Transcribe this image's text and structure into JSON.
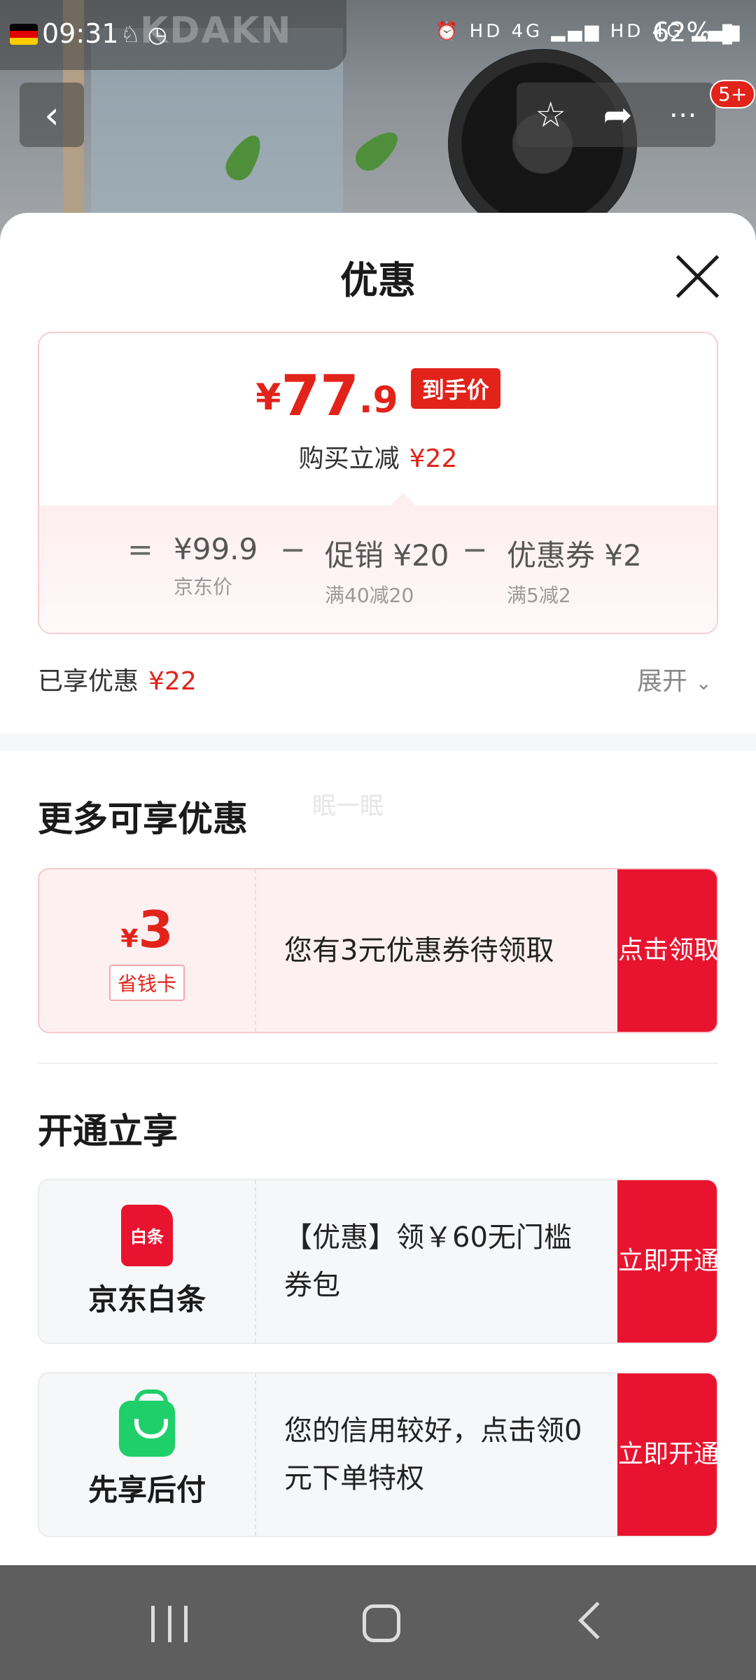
{
  "status_bar": {
    "time": "09:31",
    "network_left": "HD",
    "network_4g_a": "4G",
    "network_hd": "HD",
    "network_4g_b": "4G",
    "battery": "62%"
  },
  "background": {
    "brand_watermark": "KDAKN"
  },
  "top_actions": {
    "more_badge": "5+"
  },
  "sheet": {
    "title": "优惠",
    "price": {
      "symbol": "¥",
      "integer": "77",
      "decimal": ".9",
      "tag": "到手价",
      "instant_discount_label": "购买立减",
      "instant_discount_value": "¥22"
    },
    "breakdown": {
      "equals": "=",
      "minus": "−",
      "items": [
        {
          "value": "¥99.9",
          "note": "京东价"
        },
        {
          "value": "促销 ¥20",
          "note": "满40减20"
        },
        {
          "value": "优惠券 ¥2",
          "note": "满5减2"
        }
      ]
    },
    "enjoyed": {
      "label": "已享优惠",
      "value": "¥22",
      "expand": "展开"
    },
    "more_offers": {
      "title": "更多可享优惠",
      "ghost_text": "眠一眠",
      "coupon": {
        "symbol": "¥",
        "amount": "3",
        "tag": "省钱卡",
        "description": "您有3元优惠券待领取",
        "button": "点击领取"
      }
    },
    "activate": {
      "title": "开通立享",
      "items": [
        {
          "icon_text": "白条",
          "name": "京东白条",
          "description": "【优惠】领￥60无门槛券包",
          "button": "立即开通"
        },
        {
          "name": "先享后付",
          "description": "您的信用较好，点击领0元下单特权",
          "button": "立即开通"
        }
      ]
    }
  },
  "colors": {
    "accent_red": "#e2231a",
    "button_red": "#e8142f",
    "green": "#1fcf6a"
  }
}
